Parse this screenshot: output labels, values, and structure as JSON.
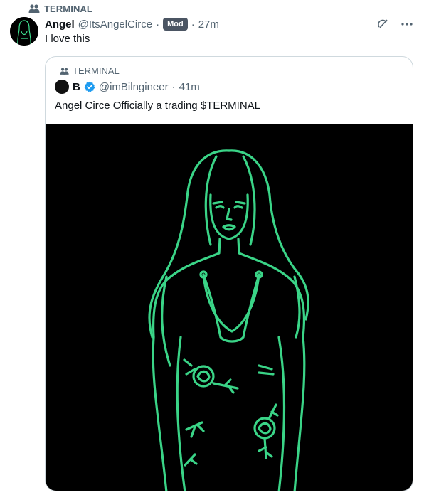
{
  "post": {
    "community": "TERMINAL",
    "author_name": "Angel",
    "author_handle": "@ItsAngelCirce",
    "separator": "·",
    "badge": "Mod",
    "time": "27m",
    "text": "I love this"
  },
  "quote": {
    "community": "TERMINAL",
    "author_name": "B",
    "author_handle": "@imBilngineer",
    "separator": "·",
    "time": "41m",
    "text": "Angel Circe Officially a trading $TERMINAL"
  },
  "colors": {
    "neon": "#3ee08f",
    "muted": "#536471",
    "verified": "#1d9bf0",
    "badge": "#4b5563"
  },
  "icons": {
    "community": "people-icon",
    "grok": "grok-icon",
    "more": "more-icon",
    "verified": "verified-badge-icon"
  }
}
